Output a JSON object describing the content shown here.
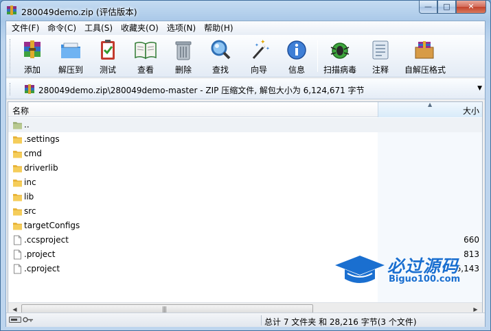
{
  "window": {
    "title": "280049demo.zip (评估版本)",
    "minimize": "—",
    "maximize": "□",
    "close": "✕"
  },
  "menu": [
    "文件(F)",
    "命令(C)",
    "工具(S)",
    "收藏夹(O)",
    "选项(N)",
    "帮助(H)"
  ],
  "toolbar": {
    "add": "添加",
    "extract": "解压到",
    "test": "测试",
    "view": "查看",
    "delete": "删除",
    "find": "查找",
    "wizard": "向导",
    "info": "信息",
    "virus_scan": "扫描病毒",
    "comment": "注释",
    "sfx": "自解压格式"
  },
  "address": {
    "path": "280049demo.zip\\280049demo-master - ZIP 压缩文件, 解包大小为 6,124,671 字节"
  },
  "columns": {
    "name": "名称",
    "size": "大小"
  },
  "files": [
    {
      "name": "..",
      "type": "up",
      "size": ""
    },
    {
      "name": ".settings",
      "type": "folder",
      "size": ""
    },
    {
      "name": "cmd",
      "type": "folder",
      "size": ""
    },
    {
      "name": "driverlib",
      "type": "folder",
      "size": ""
    },
    {
      "name": "inc",
      "type": "folder",
      "size": ""
    },
    {
      "name": "lib",
      "type": "folder",
      "size": ""
    },
    {
      "name": "src",
      "type": "folder",
      "size": ""
    },
    {
      "name": "targetConfigs",
      "type": "folder",
      "size": ""
    },
    {
      "name": ".ccsproject",
      "type": "file",
      "size": "660"
    },
    {
      "name": ".project",
      "type": "file",
      "size": "813"
    },
    {
      "name": ".cproject",
      "type": "file",
      "size": "6,143"
    }
  ],
  "status": {
    "summary": "总计 7 文件夹 和 28,216 字节(3 个文件)"
  },
  "watermark": {
    "main": "必过源码",
    "sub": "Biguo100.com"
  },
  "colors": {
    "folder": "#e8b43a",
    "accent": "#1a6fd0"
  }
}
